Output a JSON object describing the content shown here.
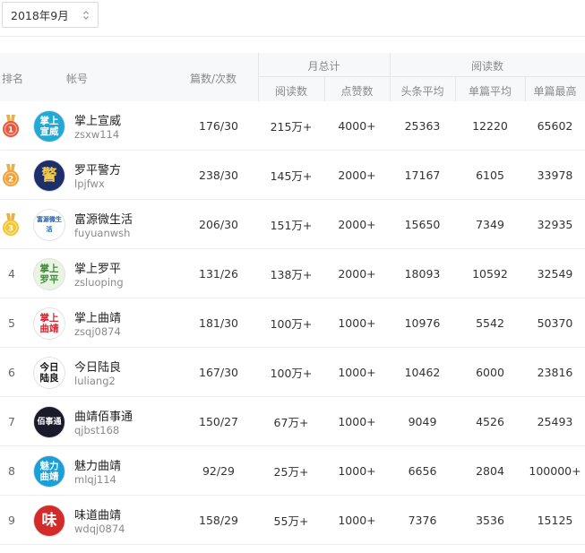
{
  "period_selector": {
    "value": "2018年9月",
    "icon": "chevron-updown-icon"
  },
  "headers": {
    "rank": "排名",
    "account": "帐号",
    "articles_times": "篇数/次数",
    "monthly_total_group": "月总计",
    "monthly_reads": "阅读数",
    "monthly_likes": "点赞数",
    "reads_group": "阅读数",
    "headline_avg": "头条平均",
    "single_avg": "单篇平均",
    "single_max": "单篇最高"
  },
  "colors": {
    "gold": "#f2b632",
    "silver": "#c9a14a",
    "bronze": "#e06a4f",
    "header_bg": "#f7f8fa"
  },
  "rows": [
    {
      "rank": "1",
      "medal": "medal-1",
      "name": "掌上宣威",
      "account": "zsxw114",
      "articles": "176/30",
      "reads": "215万+",
      "likes": "4000+",
      "headline_avg": "25363",
      "single_avg": "12220",
      "single_max": "65602",
      "avatar_text": "掌上宣威",
      "avatar_bg": "#23a9d6",
      "avatar_fg": "#ffffff"
    },
    {
      "rank": "2",
      "medal": "medal-2",
      "name": "罗平警方",
      "account": "lpjfwx",
      "articles": "238/30",
      "reads": "145万+",
      "likes": "2000+",
      "headline_avg": "17167",
      "single_avg": "6105",
      "single_max": "33978",
      "avatar_text": "警",
      "avatar_bg": "#1d2f6b",
      "avatar_fg": "#f2c94c"
    },
    {
      "rank": "3",
      "medal": "medal-3",
      "name": "富源微生活",
      "account": "fuyuanwsh",
      "articles": "206/30",
      "reads": "151万+",
      "likes": "2000+",
      "headline_avg": "15650",
      "single_avg": "7349",
      "single_max": "32935",
      "avatar_text": "富源微生活",
      "avatar_bg": "#ffffff",
      "avatar_fg": "#1f5fa8"
    },
    {
      "rank": "4",
      "medal": "",
      "name": "掌上罗平",
      "account": "zsluoping",
      "articles": "131/26",
      "reads": "138万+",
      "likes": "2000+",
      "headline_avg": "18093",
      "single_avg": "10592",
      "single_max": "32549",
      "avatar_text": "掌上罗平",
      "avatar_bg": "#e9f5e1",
      "avatar_fg": "#3c8c3c"
    },
    {
      "rank": "5",
      "medal": "",
      "name": "掌上曲靖",
      "account": "zsqj0874",
      "articles": "181/30",
      "reads": "100万+",
      "likes": "1000+",
      "headline_avg": "10976",
      "single_avg": "5542",
      "single_max": "50370",
      "avatar_text": "掌上曲靖",
      "avatar_bg": "#ffffff",
      "avatar_fg": "#d9282f"
    },
    {
      "rank": "6",
      "medal": "",
      "name": "今日陆良",
      "account": "luliang2",
      "articles": "167/30",
      "reads": "100万+",
      "likes": "1000+",
      "headline_avg": "10462",
      "single_avg": "6000",
      "single_max": "23816",
      "avatar_text": "今日陆良",
      "avatar_bg": "#ffffff",
      "avatar_fg": "#111111"
    },
    {
      "rank": "7",
      "medal": "",
      "name": "曲靖佰事通",
      "account": "qjbst168",
      "articles": "150/27",
      "reads": "67万+",
      "likes": "1000+",
      "headline_avg": "9049",
      "single_avg": "4526",
      "single_max": "25493",
      "avatar_text": "佰事通",
      "avatar_bg": "#1a1a2a",
      "avatar_fg": "#ffffff"
    },
    {
      "rank": "8",
      "medal": "",
      "name": "魅力曲靖",
      "account": "mlqj114",
      "articles": "92/29",
      "reads": "25万+",
      "likes": "1000+",
      "headline_avg": "6656",
      "single_avg": "2804",
      "single_max": "100000+",
      "avatar_text": "魅力曲靖",
      "avatar_bg": "#1a9fd8",
      "avatar_fg": "#ffffff"
    },
    {
      "rank": "9",
      "medal": "",
      "name": "味道曲靖",
      "account": "wdqj0874",
      "articles": "158/29",
      "reads": "55万+",
      "likes": "1000+",
      "headline_avg": "7376",
      "single_avg": "3536",
      "single_max": "15125",
      "avatar_text": "味",
      "avatar_bg": "#d32a2a",
      "avatar_fg": "#ffffff"
    }
  ]
}
